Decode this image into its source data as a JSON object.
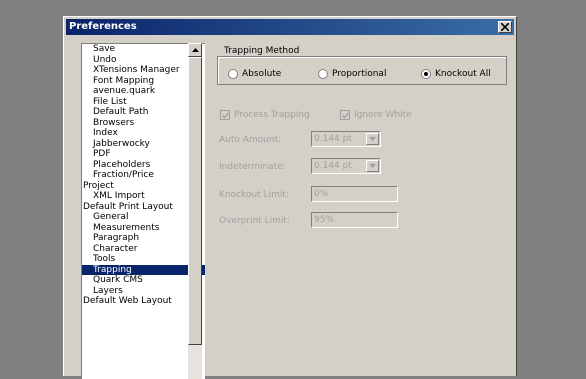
{
  "window": {
    "title": "Preferences"
  },
  "list": {
    "items": [
      {
        "label": "Save",
        "level": 1,
        "selected": false
      },
      {
        "label": "Undo",
        "level": 1,
        "selected": false
      },
      {
        "label": "XTensions Manager",
        "level": 1,
        "selected": false
      },
      {
        "label": "Font Mapping",
        "level": 1,
        "selected": false
      },
      {
        "label": "avenue.quark",
        "level": 1,
        "selected": false
      },
      {
        "label": "File List",
        "level": 1,
        "selected": false
      },
      {
        "label": "Default Path",
        "level": 1,
        "selected": false
      },
      {
        "label": "Browsers",
        "level": 1,
        "selected": false
      },
      {
        "label": "Index",
        "level": 1,
        "selected": false
      },
      {
        "label": "Jabberwocky",
        "level": 1,
        "selected": false
      },
      {
        "label": "PDF",
        "level": 1,
        "selected": false
      },
      {
        "label": "Placeholders",
        "level": 1,
        "selected": false
      },
      {
        "label": "Fraction/Price",
        "level": 1,
        "selected": false
      },
      {
        "label": "Project",
        "level": 0,
        "selected": false
      },
      {
        "label": "XML Import",
        "level": 1,
        "selected": false
      },
      {
        "label": "Default Print Layout",
        "level": 0,
        "selected": false
      },
      {
        "label": "General",
        "level": 1,
        "selected": false
      },
      {
        "label": "Measurements",
        "level": 1,
        "selected": false
      },
      {
        "label": "Paragraph",
        "level": 1,
        "selected": false
      },
      {
        "label": "Character",
        "level": 1,
        "selected": false
      },
      {
        "label": "Tools",
        "level": 1,
        "selected": false
      },
      {
        "label": "Trapping",
        "level": 1,
        "selected": true
      },
      {
        "label": "Quark CMS",
        "level": 1,
        "selected": false
      },
      {
        "label": "Layers",
        "level": 1,
        "selected": false
      },
      {
        "label": "Default Web Layout",
        "level": 0,
        "selected": false
      }
    ]
  },
  "trapping_method": {
    "legend": "Trapping Method",
    "options": [
      "Absolute",
      "Proportional",
      "Knockout All"
    ],
    "selected": "Knockout All"
  },
  "checks": {
    "process_trapping": {
      "label": "Process Trapping",
      "checked": true
    },
    "ignore_white": {
      "label": "Ignore White",
      "checked": true
    }
  },
  "fields": {
    "auto_amount": {
      "label": "Auto Amount:",
      "value": "0.144 pt"
    },
    "indeterminate": {
      "label": "Indeterminate:",
      "value": "0.144 pt"
    },
    "knockout_limit": {
      "label": "Knockout Limit:",
      "value": "0%"
    },
    "overprint_limit": {
      "label": "Overprint Limit:",
      "value": "95%"
    }
  },
  "icons": {
    "close": "close-x-icon",
    "scroll_up": "arrow-up-icon",
    "dropdown": "chevron-down-icon",
    "check": "checkmark-icon"
  }
}
